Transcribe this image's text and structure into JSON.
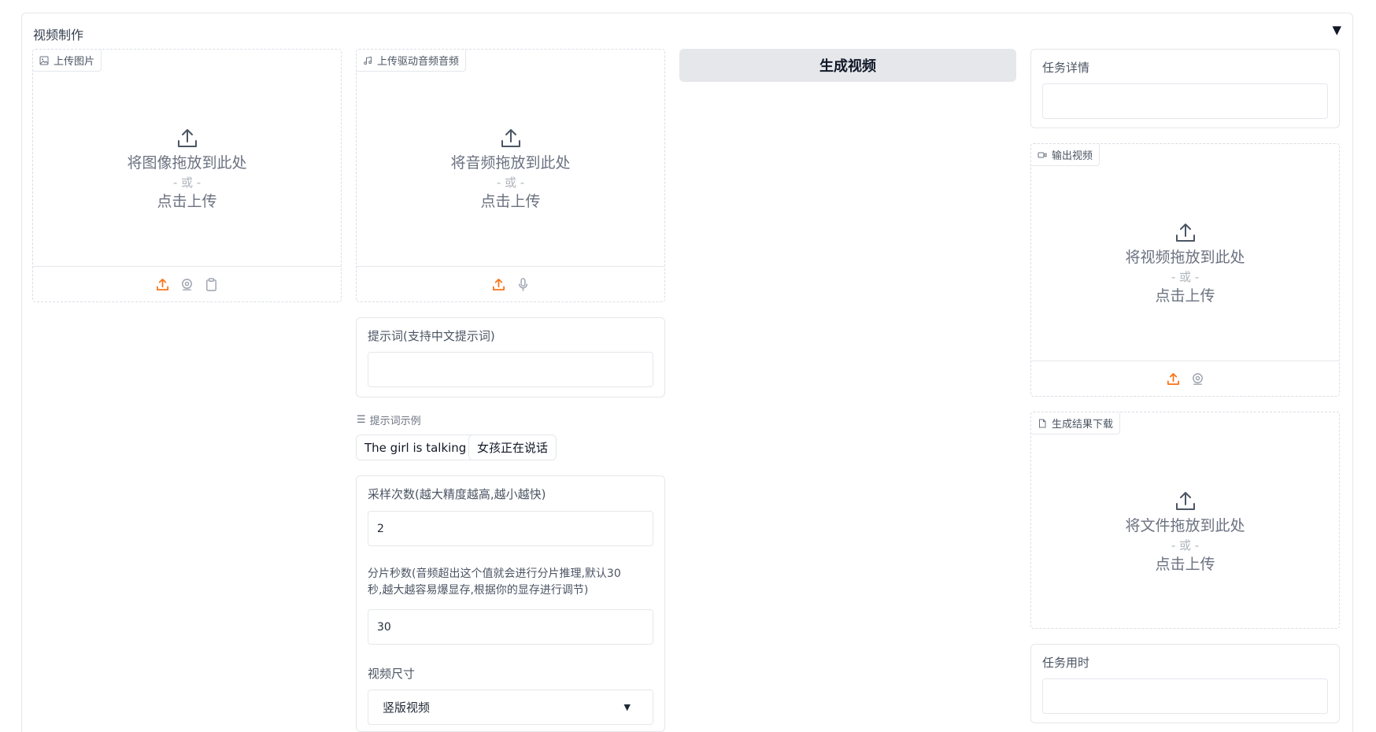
{
  "accordion": {
    "title": "视频制作",
    "toggle_icon": "triangle-down-icon"
  },
  "image_upload": {
    "label": "上传图片",
    "drop_text": "将图像拖放到此处",
    "or_text": "- 或 -",
    "click_text": "点击上传"
  },
  "audio_upload": {
    "label": "上传驱动音频音频",
    "drop_text": "将音频拖放到此处",
    "or_text": "- 或 -",
    "click_text": "点击上传"
  },
  "prompt": {
    "label": "提示词(支持中文提示词)",
    "value": ""
  },
  "examples": {
    "label": "提示词示例",
    "items": [
      "The girl is talking",
      "女孩正在说话"
    ]
  },
  "settings": {
    "steps_label": "采样次数(越大精度越高,越小越快)",
    "steps_value": "2",
    "chunk_label_line1": "分片秒数(音频超出这个值就会进行分片推理,默认30",
    "chunk_label_line2": "秒,越大越容易爆显存,根据你的显存进行调节)",
    "chunk_value": "30",
    "size_label": "视频尺寸",
    "size_value": "竖版视频"
  },
  "generate_button": {
    "label": "生成视频"
  },
  "task_detail": {
    "label": "任务详情",
    "value": ""
  },
  "output_video": {
    "label": "输出视频",
    "drop_text": "将视频拖放到此处",
    "or_text": "- 或 -",
    "click_text": "点击上传"
  },
  "result_download": {
    "label": "生成结果下载",
    "drop_text": "将文件拖放到此处",
    "or_text": "- 或 -",
    "click_text": "点击上传"
  },
  "task_time": {
    "label": "任务用时",
    "value": ""
  },
  "colors": {
    "accent": "#f97316",
    "icon_gray": "#9ca3af",
    "button_bg": "#e5e7eb"
  }
}
